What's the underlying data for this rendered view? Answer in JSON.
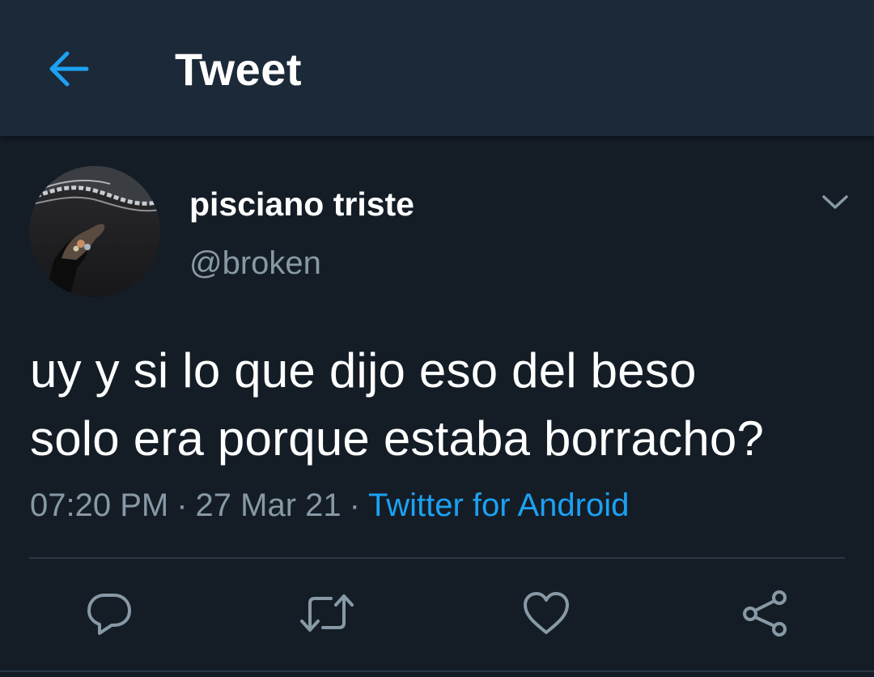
{
  "header": {
    "title": "Tweet",
    "back_icon": "back-arrow-icon"
  },
  "tweet": {
    "author": {
      "display_name": "pisciano triste",
      "handle": "@broken"
    },
    "text_lines": [
      "uy y si lo que dijo eso del beso",
      "solo era porque estaba borracho?"
    ],
    "time": "07:20 PM",
    "separator": "·",
    "date": "27 Mar 21",
    "source": "Twitter for Android"
  },
  "actions": [
    {
      "name": "reply",
      "icon": "reply-icon"
    },
    {
      "name": "retweet",
      "icon": "retweet-icon"
    },
    {
      "name": "like",
      "icon": "heart-icon"
    },
    {
      "name": "share",
      "icon": "share-icon"
    }
  ],
  "colors": {
    "background": "#141d26",
    "header": "#1c2938",
    "accent": "#1da1f2",
    "secondary_text": "#8899a6",
    "divider": "#2a3845"
  }
}
